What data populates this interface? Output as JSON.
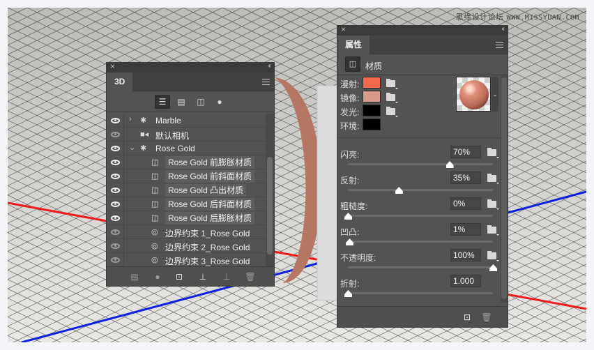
{
  "watermark": {
    "text": "思缘设计论坛",
    "url": "WWW.MISSYUAN.COM"
  },
  "scene": {
    "axis_colors": {
      "x": "#ee1c1c",
      "z": "#1020e0"
    },
    "object_color": "#b67664",
    "marble_color": "#dcdcdc"
  },
  "panel3d": {
    "close": "×",
    "collapse": "‹‹",
    "tab": "3D",
    "filters": [
      {
        "name": "whole-scene",
        "glyph": "☰",
        "active": true
      },
      {
        "name": "meshes",
        "glyph": "▤",
        "active": false
      },
      {
        "name": "materials",
        "glyph": "◫",
        "active": false
      },
      {
        "name": "lights",
        "glyph": "●",
        "active": false
      }
    ],
    "rows": [
      {
        "label": "Marble",
        "type": "mesh",
        "twisty": "›",
        "eye": "on",
        "highlight": false
      },
      {
        "label": "默认相机",
        "type": "camera",
        "twisty": "",
        "eye": "dim",
        "highlight": false
      },
      {
        "label": "Rose Gold",
        "type": "mesh",
        "twisty": "⌄",
        "eye": "on",
        "highlight": false
      },
      {
        "label": "Rose Gold 前膨胀材质",
        "type": "material",
        "twisty": "",
        "eye": "on",
        "highlight": true
      },
      {
        "label": "Rose Gold 前斜面材质",
        "type": "material",
        "twisty": "",
        "eye": "on",
        "highlight": true
      },
      {
        "label": "Rose Gold 凸出材质",
        "type": "material",
        "twisty": "",
        "eye": "on",
        "highlight": true
      },
      {
        "label": "Rose Gold 后斜面材质",
        "type": "material",
        "twisty": "",
        "eye": "on",
        "highlight": true
      },
      {
        "label": "Rose Gold 后膨胀材质",
        "type": "material",
        "twisty": "",
        "eye": "on",
        "highlight": true
      },
      {
        "label": "边界约束 1_Rose Gold",
        "type": "constraint",
        "twisty": "",
        "eye": "dim",
        "highlight": false
      },
      {
        "label": "边界约束 2_Rose Gold",
        "type": "constraint",
        "twisty": "",
        "eye": "dim",
        "highlight": false
      },
      {
        "label": "边界约束 3_Rose Gold",
        "type": "constraint",
        "twisty": "",
        "eye": "dim",
        "highlight": false
      }
    ],
    "bottom_buttons": [
      {
        "name": "mesh-icon",
        "glyph": "▤",
        "bright": false
      },
      {
        "name": "light-bulb-icon",
        "glyph": "●",
        "bright": false
      },
      {
        "name": "render-icon",
        "glyph": "⊡",
        "bright": true
      },
      {
        "name": "drop-to-ground-icon",
        "glyph": "⊥",
        "bright": true
      },
      {
        "name": "add-constraint-icon",
        "glyph": "⊥",
        "bright": false
      },
      {
        "name": "trash-icon",
        "glyph": "🗑",
        "bright": false
      }
    ]
  },
  "props": {
    "close": "×",
    "collapse": "‹‹",
    "tab": "属性",
    "section": "材质",
    "colors": [
      {
        "label": "漫射:",
        "color": "#ef6a4a",
        "folder": true
      },
      {
        "label": "镜像:",
        "color": "#d99a8e",
        "folder": true
      },
      {
        "label": "发光:",
        "color": "#000000",
        "folder": true
      },
      {
        "label": "环境:",
        "color": "#000000",
        "folder": false
      }
    ],
    "sliders": [
      {
        "label": "闪亮:",
        "value": "70%",
        "fraction": 0.7,
        "folder": true
      },
      {
        "label": "反射:",
        "value": "35%",
        "fraction": 0.35,
        "folder": true
      },
      {
        "label": "粗糙度:",
        "value": "0%",
        "fraction": 0.0,
        "folder": true
      },
      {
        "label": "凹凸:",
        "value": "1%",
        "fraction": 0.01,
        "folder": true
      },
      {
        "label": "不透明度:",
        "value": "100%",
        "fraction": 1.0,
        "folder": true
      },
      {
        "label": "折射:",
        "value": "1.000",
        "fraction": 0.0,
        "folder": false
      }
    ],
    "preview_dropdown": "⌄",
    "bottom_buttons": [
      {
        "name": "render-icon",
        "glyph": "⊡",
        "bright": true
      },
      {
        "name": "trash-icon",
        "glyph": "🗑",
        "bright": false
      }
    ]
  }
}
